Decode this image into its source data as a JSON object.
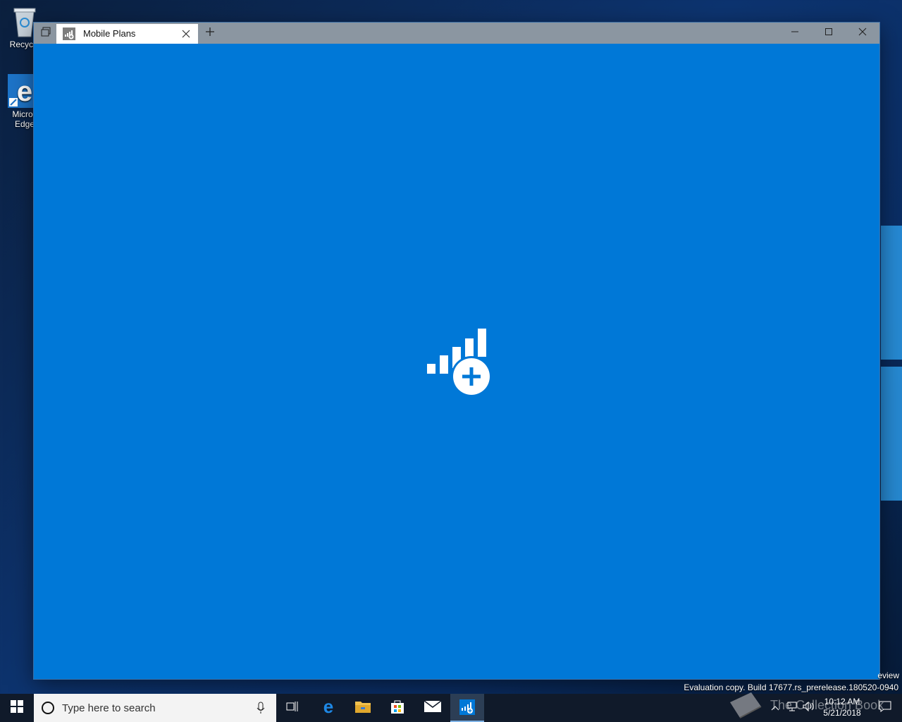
{
  "desktop": {
    "icons": [
      {
        "label": "Recycle"
      },
      {
        "label": "Micros Edge"
      }
    ],
    "edge_icon_line1": "Micros",
    "edge_icon_line2": "Edge",
    "watermark_text": "eview",
    "evaluation_text": "Evaluation copy. Build 17677.rs_prerelease.180520-0940"
  },
  "window": {
    "tab_title": "Mobile Plans",
    "app_icon": "mobile-plans-icon",
    "background_color": "#0078d7"
  },
  "taskbar": {
    "search_placeholder": "Type here to search",
    "clock_time": "10:12 AM",
    "clock_date": "5/21/2018",
    "watermark": "The Collection Book"
  }
}
